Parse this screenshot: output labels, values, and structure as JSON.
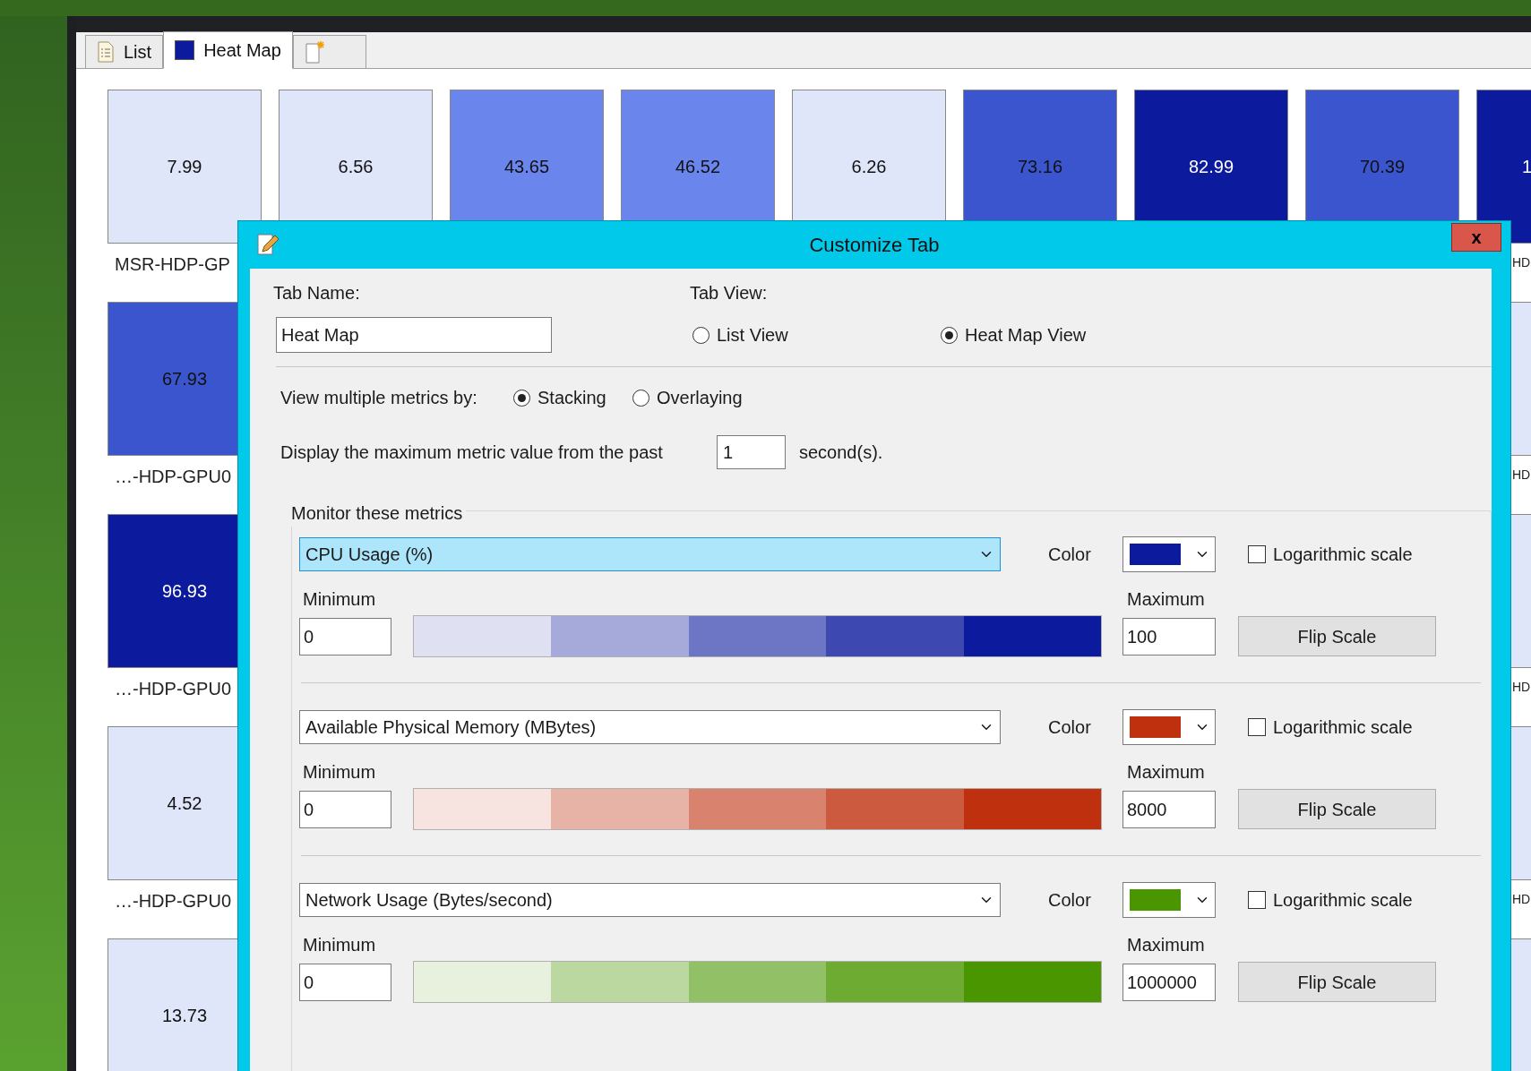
{
  "tabs": [
    {
      "kind": "list",
      "label": "List",
      "selected": false
    },
    {
      "kind": "swatch",
      "label": "Heat Map",
      "selected": true
    },
    {
      "kind": "new",
      "selected": false
    }
  ],
  "heat_map": {
    "rows": [
      {
        "tiles": [
          {
            "value": "7.99",
            "color": "#e0e6fa",
            "label": "MSR-HDP-GP"
          },
          {
            "value": "6.56",
            "color": "#e0e6fa"
          },
          {
            "value": "43.65",
            "color": "#6a86ec"
          },
          {
            "value": "46.52",
            "color": "#6a86ec"
          },
          {
            "value": "6.26",
            "color": "#e0e6fa"
          },
          {
            "value": "73.16",
            "color": "#3b55cf"
          },
          {
            "value": "82.99",
            "color": "#0c1a9e"
          },
          {
            "value": "70.39",
            "color": "#3b55cf"
          },
          {
            "value": "1",
            "color": "#0c1a9e",
            "label": "HD"
          }
        ]
      },
      {
        "tiles": [
          {
            "value": "67.93",
            "color": "#3b55cf",
            "label": "…-HDP-GPU0"
          },
          {
            "color": "#e0e6fa",
            "label": "HD"
          }
        ]
      },
      {
        "tiles": [
          {
            "value": "96.93",
            "color": "#0c1a9e",
            "label": "…-HDP-GPU0"
          },
          {
            "color": "#e0e6fa",
            "label": "HD"
          }
        ]
      },
      {
        "tiles": [
          {
            "value": "4.52",
            "color": "#e0e6fa",
            "label": "…-HDP-GPU0"
          },
          {
            "color": "#e0e6fa",
            "label": "HD"
          }
        ]
      },
      {
        "tiles": [
          {
            "value": "13.73",
            "color": "#e0e6fa"
          },
          {
            "color": "#e0e6fa"
          }
        ]
      }
    ]
  },
  "dialog": {
    "title": "Customize Tab",
    "close": "x",
    "tab_name_label": "Tab Name:",
    "tab_name": "Heat Map",
    "tab_view_label": "Tab View:",
    "tab_views": [
      {
        "label": "List View",
        "selected": false
      },
      {
        "label": "Heat Map View",
        "selected": true
      }
    ],
    "stack_label": "View multiple metrics by:",
    "stack_modes": [
      {
        "label": "Stacking",
        "selected": true
      },
      {
        "label": "Overlaying",
        "selected": false
      }
    ],
    "past_label": "Display the maximum metric value from the past",
    "past_value": "1",
    "past_unit": "second(s).",
    "metrics_title": "Monitor these metrics",
    "metrics": [
      {
        "name": "CPU Usage (%)",
        "focused": true,
        "color_label": "Color",
        "color": "#0c1a9e",
        "log_label": "Logarithmic scale",
        "logarithmic": false,
        "min_label": "Minimum",
        "min": "0",
        "max_label": "Maximum",
        "max": "100",
        "flip_label": "Flip Scale"
      },
      {
        "name": "Available Physical Memory (MBytes)",
        "focused": false,
        "color_label": "Color",
        "color": "#bf310e",
        "log_label": "Logarithmic scale",
        "logarithmic": false,
        "min_label": "Minimum",
        "min": "0",
        "max_label": "Maximum",
        "max": "8000",
        "flip_label": "Flip Scale"
      },
      {
        "name": "Network Usage (Bytes/second)",
        "focused": false,
        "color_label": "Color",
        "color": "#4a9600",
        "log_label": "Logarithmic scale",
        "logarithmic": false,
        "min_label": "Minimum",
        "min": "0",
        "max_label": "Maximum",
        "max": "1000000",
        "flip_label": "Flip Scale"
      }
    ]
  }
}
